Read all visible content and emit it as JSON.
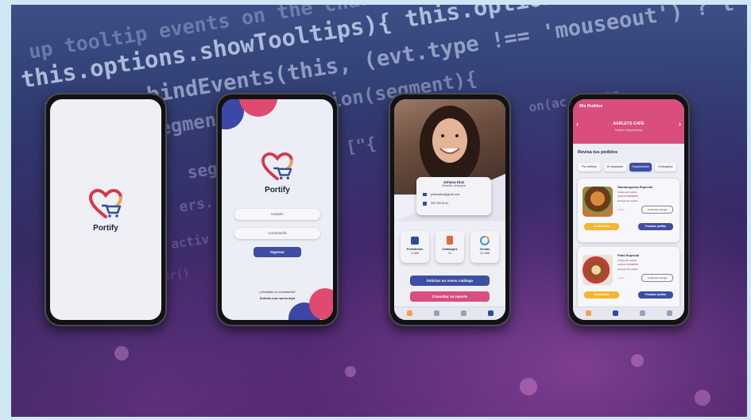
{
  "background": {
    "code_lines": [
      "up tooltip events on the chart",
      "this.options.showTooltips){   this.options.tooltipEvents,",
      "helpers.bindEvents(this,   (evt.type !== 'mouseout') ? t",
      ".activeSegments = function(segment){",
      "segm   .segments,   [\"{",
      "ers.",
      "activ",
      "er()"
    ],
    "right_code": "on(ac   eSegme"
  },
  "colors": {
    "pink": "#d94e7c",
    "navy": "#3d4ea3",
    "blob_blue": "#3c47a6",
    "blob_pink": "#e04a70",
    "heart_red": "#d9354b",
    "heart_orange": "#f0a24a",
    "cart_blue": "#2d4ea0"
  },
  "phone1": {
    "brand": "Portify"
  },
  "phone2": {
    "brand": "Portify",
    "username_placeholder": "Usuario",
    "password_placeholder": "Contraseña",
    "login_button": "Ingresar",
    "forgot_password": "¿Olvidaste tu contraseña?",
    "request_account": "Solicita una nueva aquí"
  },
  "phone3": {
    "profile_name": "Johana Diaz",
    "profile_location": "Medellín, Antioquia",
    "profile_email": "johanadiaz@gmail.com",
    "profile_phone": "300 754 26 41",
    "stats": [
      {
        "label": "Portafolios",
        "value": "1,086"
      },
      {
        "label": "Catálogos",
        "value": "11"
      },
      {
        "label": "Ventas",
        "value": "12,386"
      }
    ],
    "request_catalog_button": "Solicitar un nuevo catálogo",
    "report_button": "Consultar su reporte"
  },
  "phone4": {
    "title": "Mis Pedidos",
    "store": "AARLEYS CAFÉ",
    "store_subtitle": "Pedidos Despachados",
    "section_title": "Revisa tus pedidos",
    "filters": [
      "Por verificar",
      "En despacho",
      "Despachados",
      "Entregados"
    ],
    "orders": [
      {
        "name": "Hamburguesa Especial",
        "code_label": "Código del pedido:",
        "code": "AARLEYS6598785",
        "delivery_label": "Entrega del pedido:",
        "qty": "1 Item",
        "button_outline": "Confirmar entrega",
        "button_yellow": "Confirmado",
        "button_blue": "Finalizar pedido"
      },
      {
        "name": "Plato Especial",
        "code_label": "Código del pedido:",
        "code": "AARLEYS6598785",
        "delivery_label": "Entrega del pedido:",
        "qty": "1 Item",
        "button_outline": "Confirmar entrega",
        "button_yellow": "Confirmado",
        "button_blue": "Finalizar pedido"
      }
    ]
  }
}
